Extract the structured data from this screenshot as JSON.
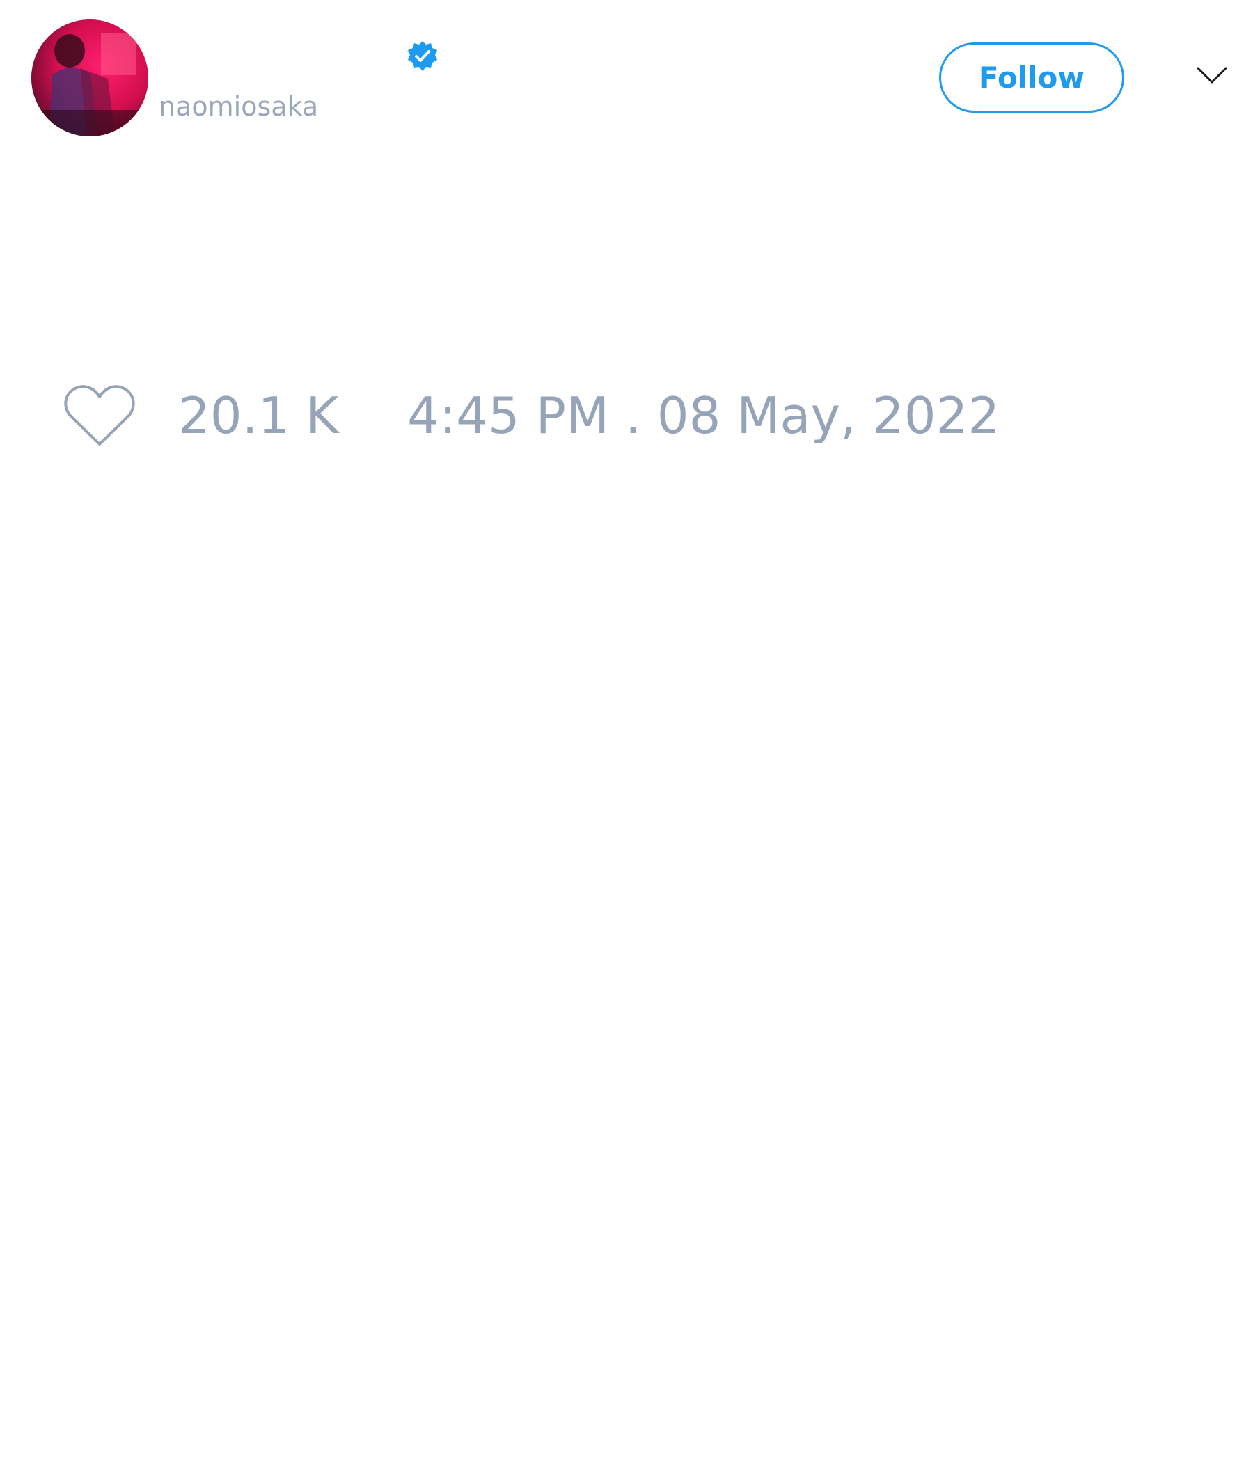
{
  "author": {
    "handle": "naomiosaka",
    "verified": true,
    "avatar_icon": "profile-photo",
    "verified_icon": "verified-badge-icon"
  },
  "header": {
    "follow_label": "Follow",
    "menu_icon": "chevron-down-icon"
  },
  "stats": {
    "like_icon": "heart-outline-icon",
    "likes": "20.1 K",
    "timestamp": "4:45 PM . 08 May, 2022"
  },
  "colors": {
    "accent": "#1d9bf0",
    "muted_text": "#95a4b8",
    "background": "#ffffff"
  }
}
